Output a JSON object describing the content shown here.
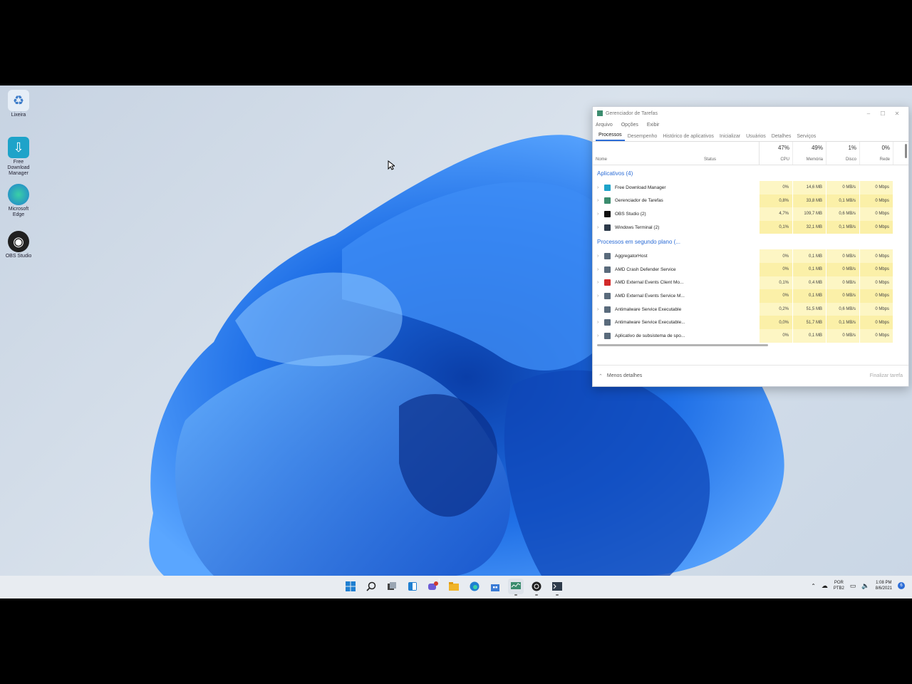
{
  "desktop": {
    "icons": [
      {
        "label": "Lixeira",
        "icon": "recycle-bin-icon",
        "color": "#6fa8dc"
      },
      {
        "label": "Free Download Manager",
        "icon": "download-manager-icon",
        "color": "#1ea3c9"
      },
      {
        "label": "Microsoft Edge",
        "icon": "edge-icon",
        "color": "#1f7fd1"
      },
      {
        "label": "OBS Studio",
        "icon": "obs-icon",
        "color": "#202020"
      }
    ]
  },
  "task_manager": {
    "title": "Gerenciador de Tarefas",
    "menu": [
      "Arquivo",
      "Opções",
      "Exibir"
    ],
    "tabs": [
      "Processos",
      "Desempenho",
      "Histórico de aplicativos",
      "Inicializar",
      "Usuários",
      "Detalhes",
      "Serviços"
    ],
    "active_tab": "Processos",
    "columns": {
      "name": "Nome",
      "status": "Status",
      "cpu": {
        "pct": "47%",
        "label": "CPU"
      },
      "memory": {
        "pct": "49%",
        "label": "Memória"
      },
      "disk": {
        "pct": "1%",
        "label": "Disco"
      },
      "network": {
        "pct": "0%",
        "label": "Rede"
      }
    },
    "groups": [
      {
        "title": "Aplicativos (4)",
        "rows": [
          {
            "name": "Free Download Manager",
            "icon_color": "#1ea3c9",
            "cpu": "0%",
            "mem": "14,6 MB",
            "disk": "0 MB/s",
            "net": "0 Mbps"
          },
          {
            "name": "Gerenciador de Tarefas",
            "icon_color": "#3b8c6e",
            "cpu": "0,8%",
            "mem": "33,8 MB",
            "disk": "0,1 MB/s",
            "net": "0 Mbps"
          },
          {
            "name": "OBS Studio (2)",
            "icon_color": "#111111",
            "cpu": "4,7%",
            "mem": "109,7 MB",
            "disk": "0,6 MB/s",
            "net": "0 Mbps"
          },
          {
            "name": "Windows Terminal (2)",
            "icon_color": "#2d3a4a",
            "cpu": "0,1%",
            "mem": "32,1 MB",
            "disk": "0,1 MB/s",
            "net": "0 Mbps"
          }
        ]
      },
      {
        "title": "Processos em segundo plano (...",
        "rows": [
          {
            "name": "AggregatorHost",
            "icon_color": "#5a6b7c",
            "cpu": "0%",
            "mem": "0,1 MB",
            "disk": "0 MB/s",
            "net": "0 Mbps"
          },
          {
            "name": "AMD Crash Defender Service",
            "icon_color": "#5a6b7c",
            "cpu": "0%",
            "mem": "0,1 MB",
            "disk": "0 MB/s",
            "net": "0 Mbps"
          },
          {
            "name": "AMD External Events Client Mo...",
            "icon_color": "#d22b2b",
            "cpu": "0,1%",
            "mem": "0,4 MB",
            "disk": "0 MB/s",
            "net": "0 Mbps"
          },
          {
            "name": "AMD External Events Service M...",
            "icon_color": "#5a6b7c",
            "cpu": "0%",
            "mem": "0,1 MB",
            "disk": "0 MB/s",
            "net": "0 Mbps"
          },
          {
            "name": "Antimalware Service Executable",
            "icon_color": "#5a6b7c",
            "cpu": "0,2%",
            "mem": "51,5 MB",
            "disk": "0,6 MB/s",
            "net": "0 Mbps"
          },
          {
            "name": "Antimalware Service Executable...",
            "icon_color": "#5a6b7c",
            "cpu": "0,0%",
            "mem": "51,7 MB",
            "disk": "0,1 MB/s",
            "net": "0 Mbps"
          },
          {
            "name": "Aplicativo de subsistema de spo...",
            "icon_color": "#5a6b7c",
            "cpu": "0%",
            "mem": "0,1 MB",
            "disk": "0 MB/s",
            "net": "0 Mbps"
          }
        ]
      }
    ],
    "footer": {
      "less_details": "Menos detalhes",
      "end_task": "Finalizar tarefa"
    }
  },
  "taskbar": {
    "apps": [
      "start-icon",
      "search-icon",
      "task-view-icon",
      "widgets-icon",
      "chat-icon",
      "file-explorer-icon",
      "edge-icon",
      "store-icon",
      "task-manager-icon",
      "obs-icon",
      "terminal-icon"
    ],
    "language_top": "POR",
    "language_bottom": "PTB2",
    "time": "1:08 PM",
    "date": "8/6/2021",
    "notification_count": "6",
    "chat_badge": "1"
  }
}
